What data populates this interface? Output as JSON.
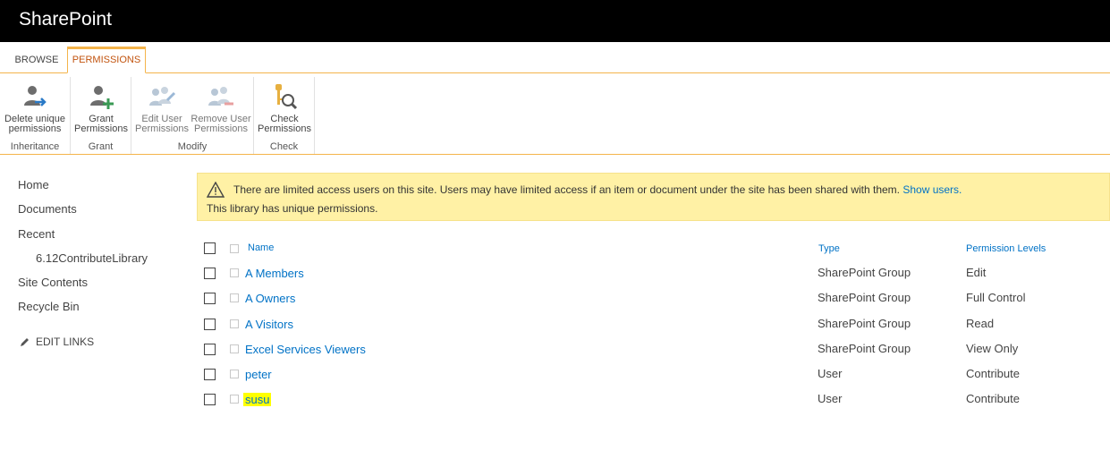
{
  "suite": {
    "brand": "SharePoint"
  },
  "tabs": [
    {
      "label": "BROWSE"
    },
    {
      "label": "PERMISSIONS"
    }
  ],
  "ribbon": {
    "groups": [
      {
        "label": "Inheritance",
        "buttons": [
          {
            "line1": "Delete unique",
            "line2": "permissions"
          }
        ]
      },
      {
        "label": "Grant",
        "buttons": [
          {
            "line1": "Grant",
            "line2": "Permissions"
          }
        ]
      },
      {
        "label": "Modify",
        "buttons": [
          {
            "line1": "Edit User",
            "line2": "Permissions"
          },
          {
            "line1": "Remove User",
            "line2": "Permissions"
          }
        ]
      },
      {
        "label": "Check",
        "buttons": [
          {
            "line1": "Check",
            "line2": "Permissions"
          }
        ]
      }
    ]
  },
  "nav": {
    "items": [
      {
        "label": "Home"
      },
      {
        "label": "Documents"
      },
      {
        "label": "Recent"
      },
      {
        "label": "6.12ContributeLibrary"
      },
      {
        "label": "Site Contents"
      },
      {
        "label": "Recycle Bin"
      }
    ],
    "edit_links": "EDIT LINKS"
  },
  "banner": {
    "message": "There are limited access users on this site. Users may have limited access if an item or document under the site has been shared with them.",
    "link": "Show users.",
    "unique": "This library has unique permissions."
  },
  "table": {
    "headers": {
      "name": "Name",
      "type": "Type",
      "perm": "Permission Levels"
    },
    "rows": [
      {
        "name": "A Members",
        "type": "SharePoint Group",
        "perm": "Edit"
      },
      {
        "name": "A Owners",
        "type": "SharePoint Group",
        "perm": "Full Control"
      },
      {
        "name": "A Visitors",
        "type": "SharePoint Group",
        "perm": "Read"
      },
      {
        "name": "Excel Services Viewers",
        "type": "SharePoint Group",
        "perm": "View Only"
      },
      {
        "name": "peter",
        "type": "User",
        "perm": "Contribute"
      },
      {
        "name": "susu",
        "type": "User",
        "perm": "Contribute",
        "highlight": "#ffff00"
      }
    ]
  },
  "colors": {
    "accent": "#f4b44b",
    "link": "#0072c6",
    "banner": "#fff1a5",
    "active_tab_text": "#c2540f"
  }
}
